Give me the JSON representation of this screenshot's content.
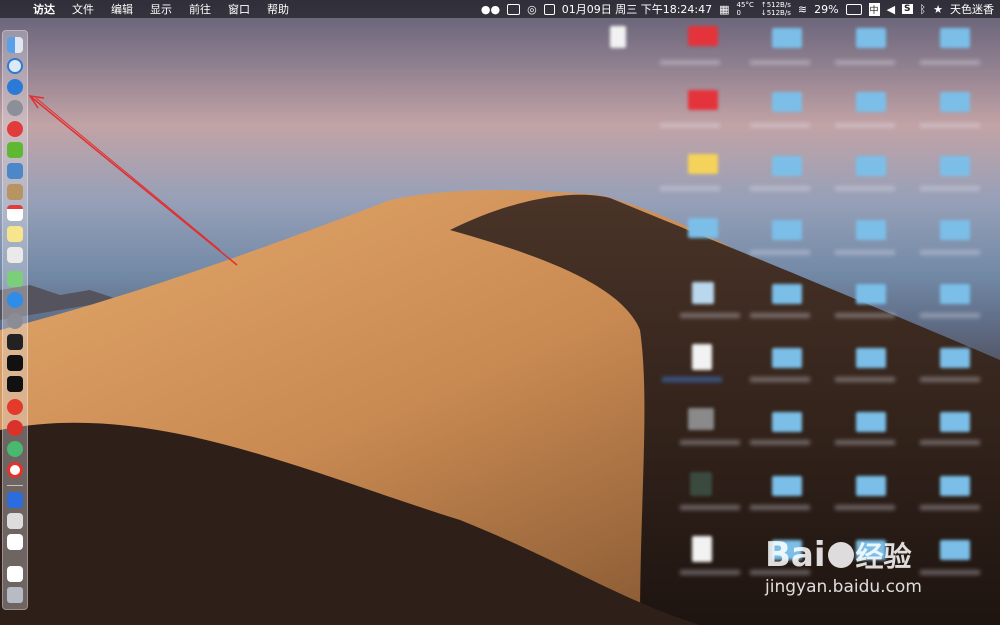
{
  "menubar": {
    "apple": "",
    "items": [
      "访达",
      "文件",
      "编辑",
      "显示",
      "前往",
      "窗口",
      "帮助"
    ],
    "datetime": "01月09日 周三 下午18:24:47",
    "temp_top": "45°C",
    "temp_bottom": "0",
    "net_up": "↑512B/s",
    "net_down": "↓512B/s",
    "battery": "29%",
    "input": "中",
    "username": "天色迷香"
  },
  "dock": {
    "icons": [
      "finder-icon",
      "safari-icon",
      "safari-highlight-icon",
      "launchpad-icon",
      "app-red-icon",
      "android-icon",
      "preview-icon",
      "notes-icon",
      "calendar-icon",
      "reminders-icon",
      "maps-icon",
      "appstore-icon",
      "system-preferences-icon",
      "activity-monitor-icon",
      "terminal-icon",
      "vivaldi-icon",
      "netease-music-icon",
      "wechat-icon",
      "yandex-icon",
      "sogou-icon",
      "text-editor-icon",
      "file-icon",
      "trash-icon"
    ]
  },
  "watermark": {
    "brand": "Bai",
    "brand2": "经验",
    "url": "jingyan.baidu.com"
  }
}
